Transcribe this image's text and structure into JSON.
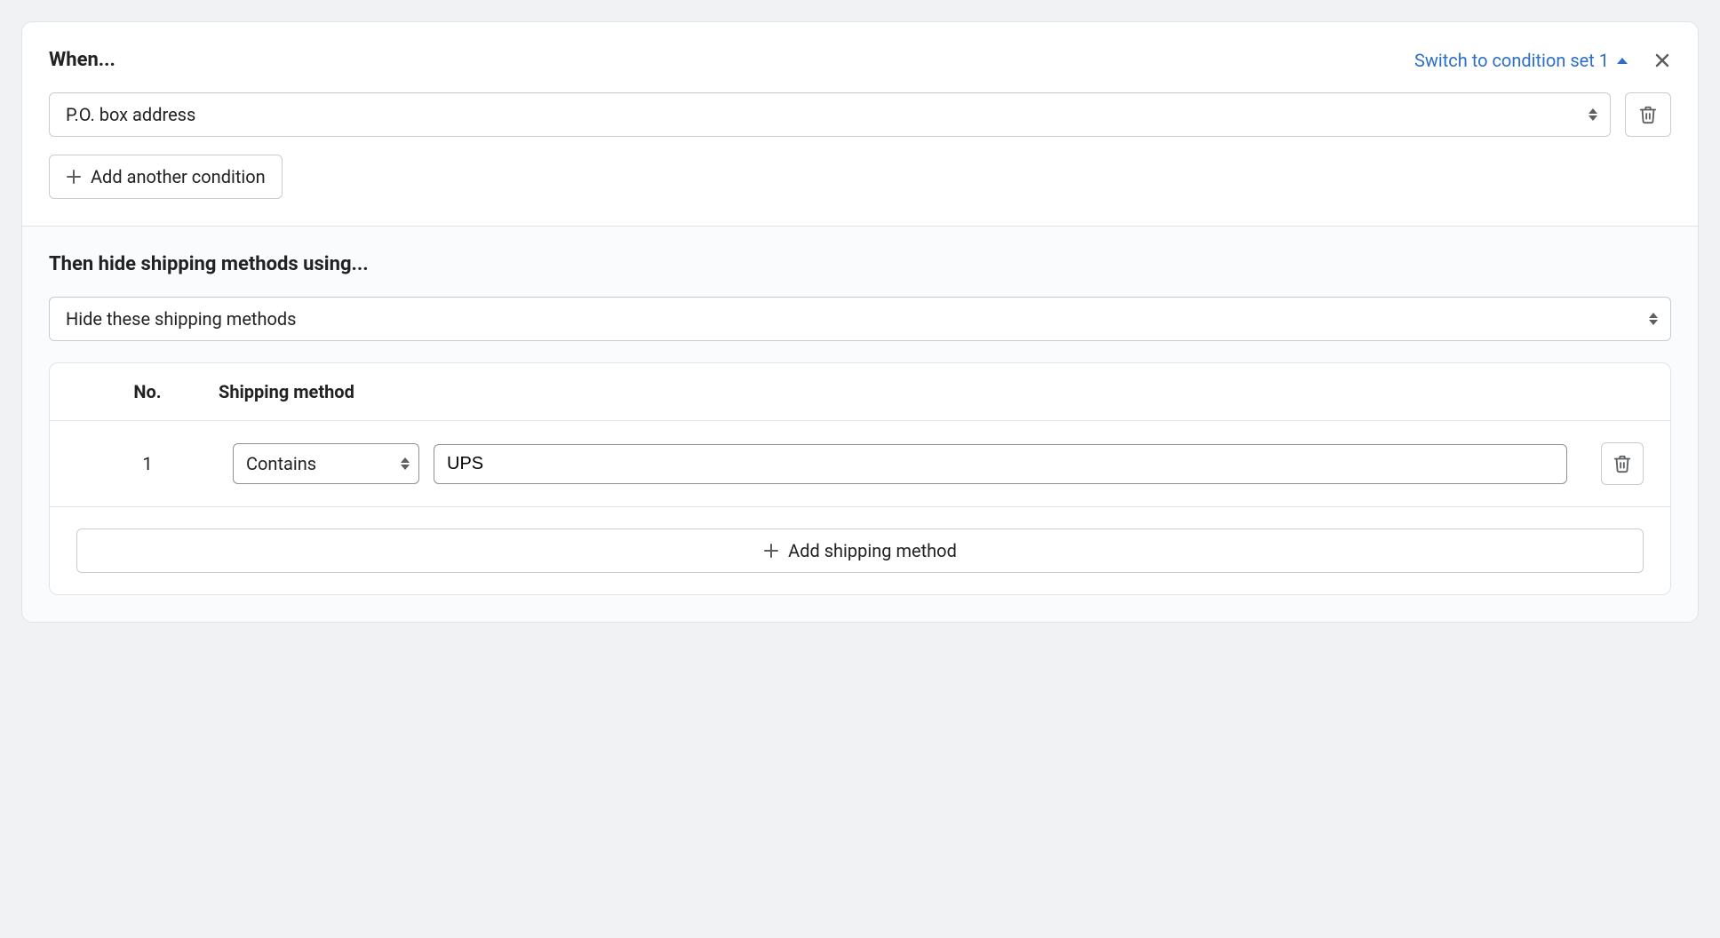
{
  "when": {
    "title": "When...",
    "switch_label": "Switch to condition set 1",
    "conditions": [
      {
        "type_label": "P.O. box address"
      }
    ],
    "add_condition_label": "Add another condition"
  },
  "then": {
    "title": "Then hide shipping methods using...",
    "action_label": "Hide these shipping methods",
    "table": {
      "col_no": "No.",
      "col_method": "Shipping method",
      "rows": [
        {
          "no": "1",
          "match_label": "Contains",
          "value": "UPS"
        }
      ],
      "add_method_label": "Add shipping method"
    }
  }
}
